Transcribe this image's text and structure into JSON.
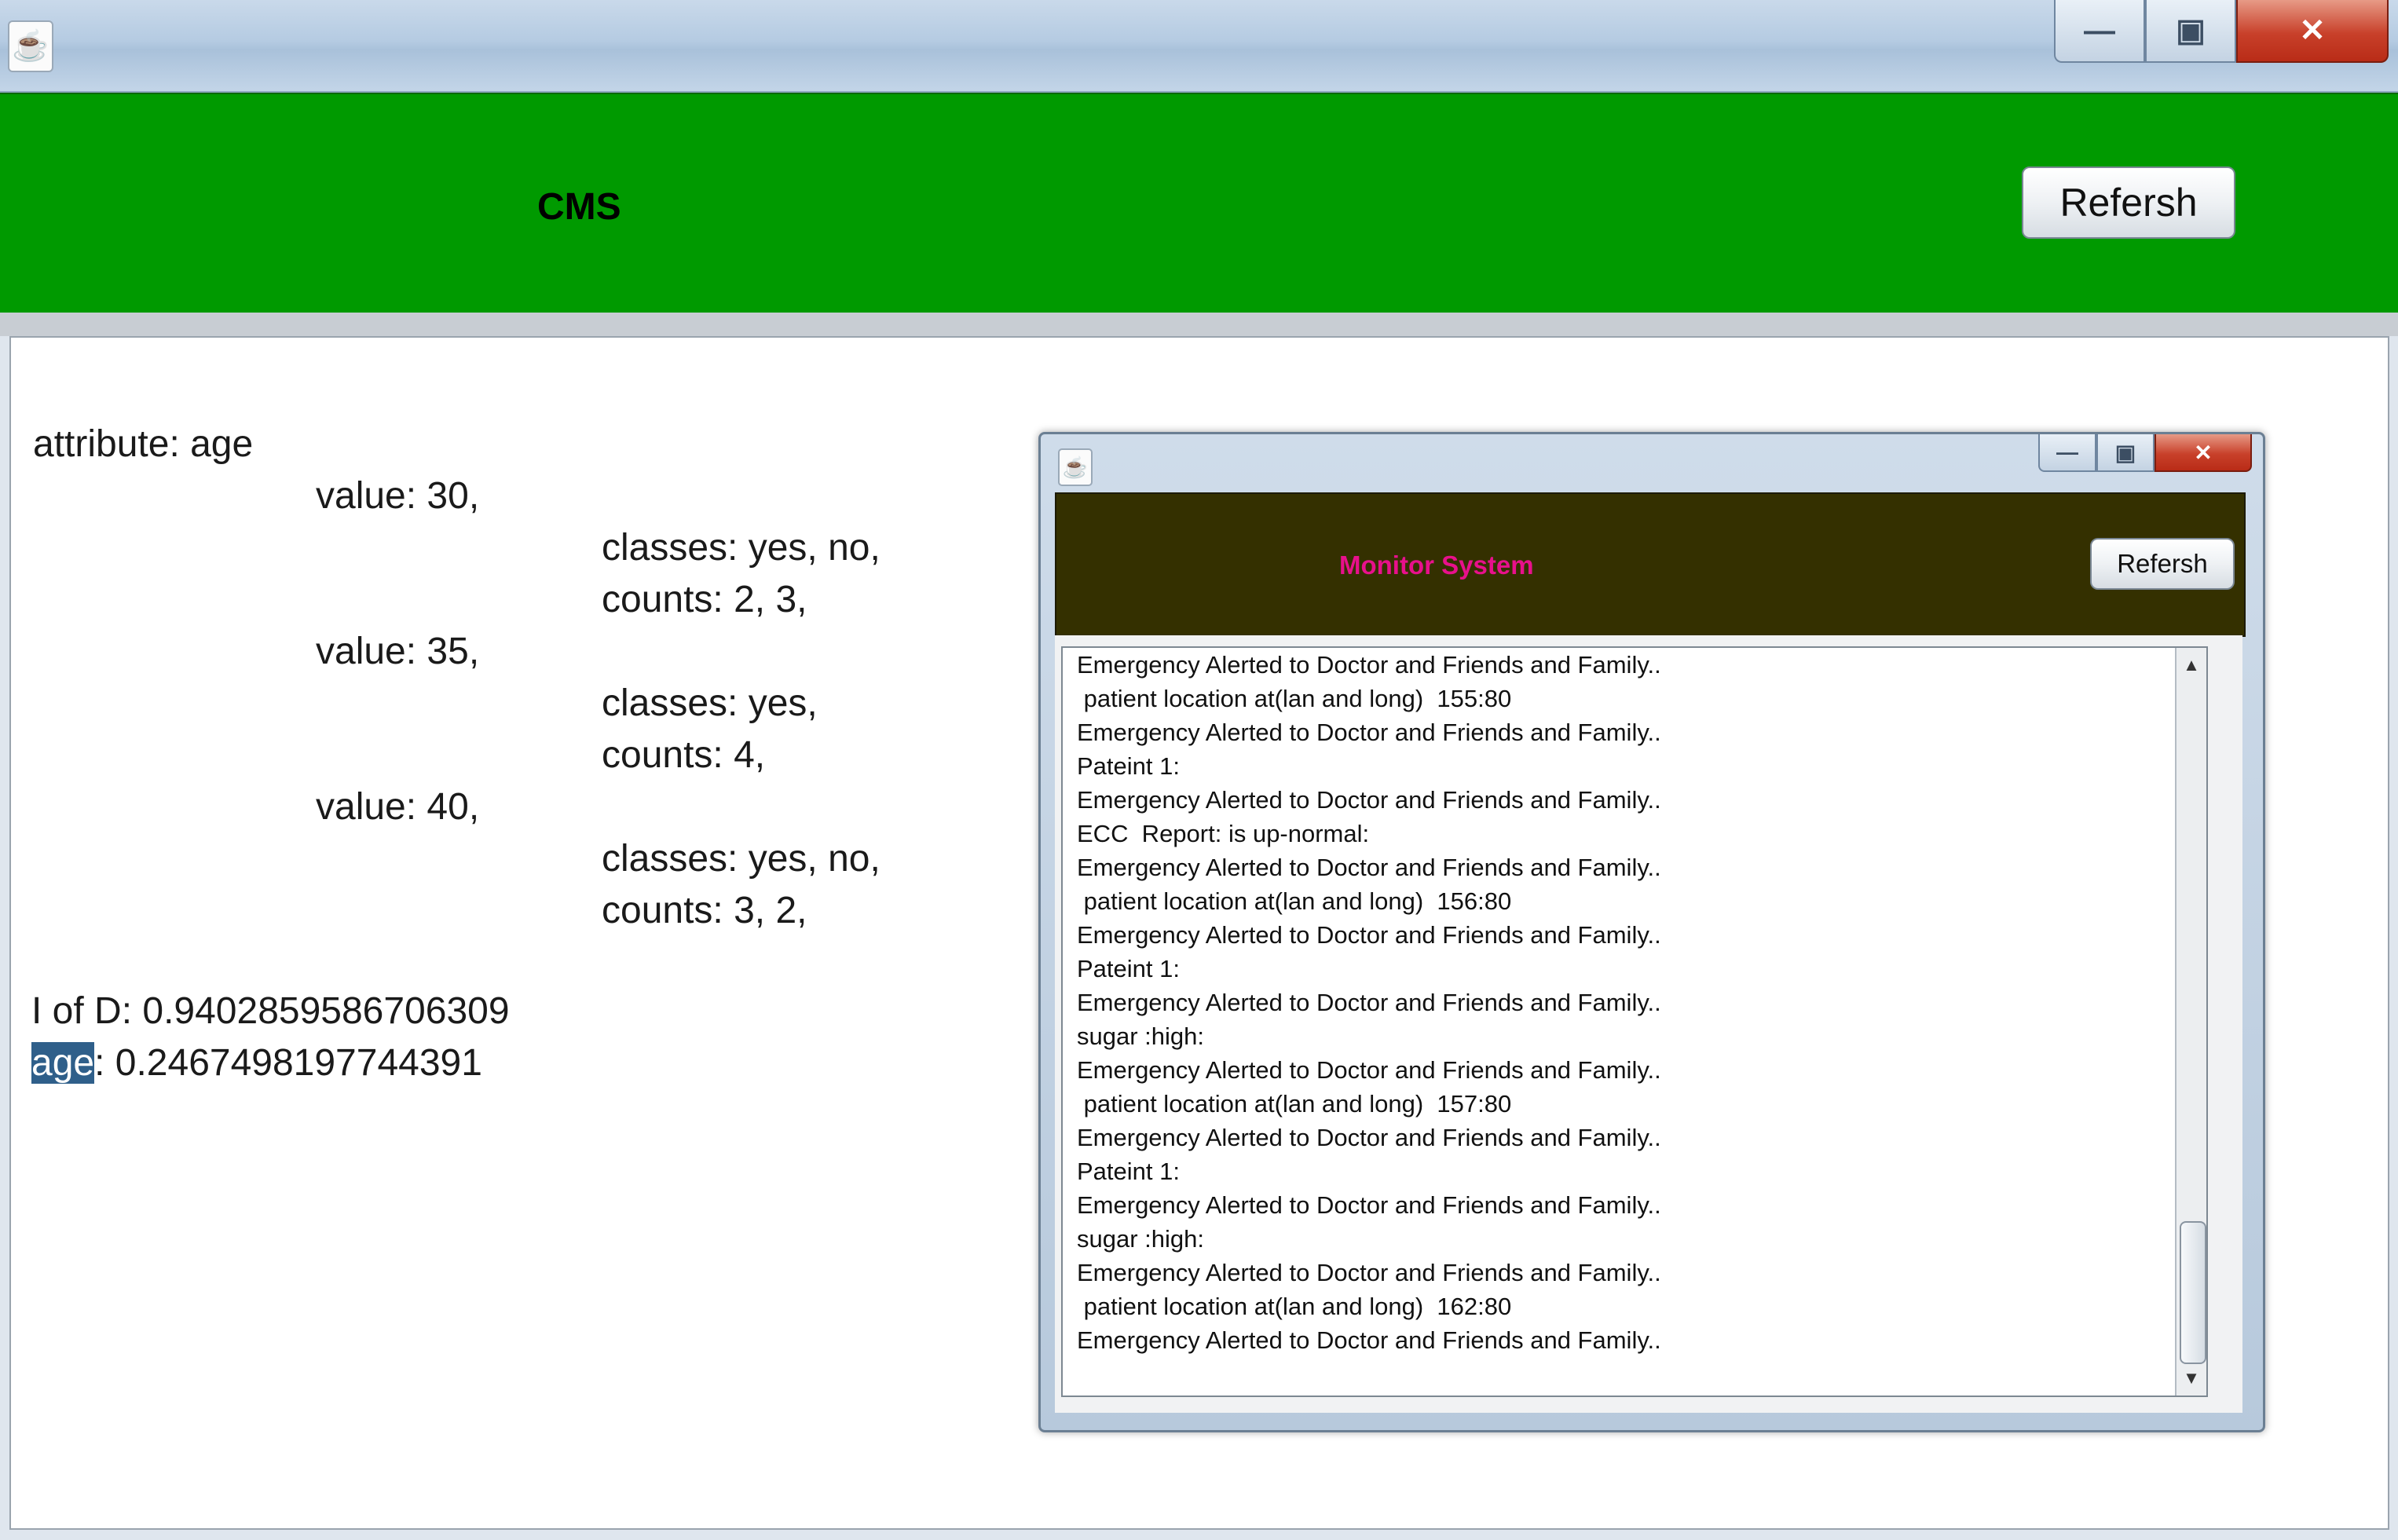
{
  "main_window": {
    "app_icon": "java-cup-icon",
    "controls": {
      "minimize": "minimize-icon",
      "maximize": "maximize-icon",
      "close": "close-icon"
    }
  },
  "header": {
    "title": "CMS",
    "refresh_label": "Refersh",
    "background": "#009a00"
  },
  "content": {
    "lines": [
      "attribute: age",
      "value: 30,",
      "classes: yes, no,",
      "counts: 2, 3,",
      "value: 35,",
      "classes: yes,",
      "counts: 4,",
      "value: 40,",
      "classes: yes, no,",
      "counts: 3, 2,",
      "I of D: 0.9402859586706309"
    ],
    "gain_label_selected": "age",
    "gain_value": ": 0.2467498197744391",
    "selection_color": "#2f5f8a"
  },
  "monitor_window": {
    "app_icon": "java-cup-icon",
    "title": "Monitor System",
    "title_color": "#e8108c",
    "header_background": "#343000",
    "refresh_label": "Refersh",
    "log": [
      "Emergency Alerted to Doctor and Friends and Family..",
      " patient location at(lan and long)  155:80",
      "Emergency Alerted to Doctor and Friends and Family..",
      "Pateint 1:",
      "Emergency Alerted to Doctor and Friends and Family..",
      "ECC  Report: is up-normal:",
      "Emergency Alerted to Doctor and Friends and Family..",
      " patient location at(lan and long)  156:80",
      "Emergency Alerted to Doctor and Friends and Family..",
      "Pateint 1:",
      "Emergency Alerted to Doctor and Friends and Family..",
      "sugar :high:",
      "Emergency Alerted to Doctor and Friends and Family..",
      " patient location at(lan and long)  157:80",
      "Emergency Alerted to Doctor and Friends and Family..",
      "Pateint 1:",
      "Emergency Alerted to Doctor and Friends and Family..",
      "sugar :high:",
      "Emergency Alerted to Doctor and Friends and Family..",
      " patient location at(lan and long)  162:80",
      "Emergency Alerted to Doctor and Friends and Family.."
    ],
    "scroll_up": "▲",
    "scroll_down": "▼"
  }
}
